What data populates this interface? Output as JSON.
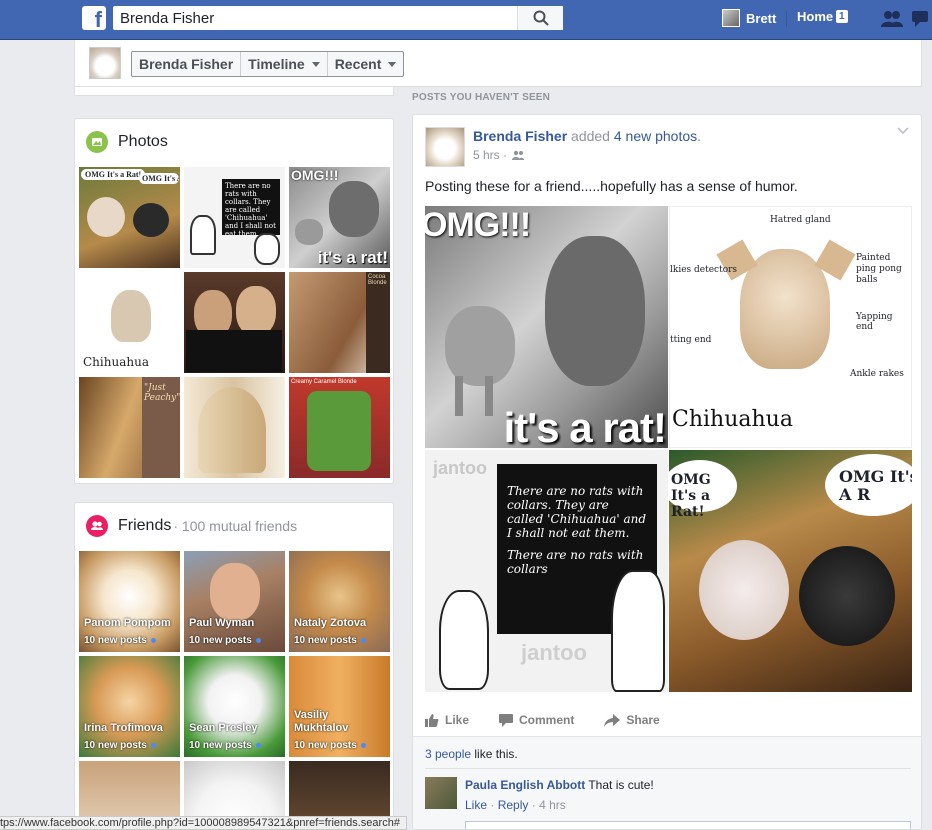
{
  "topbar": {
    "logo": "f",
    "search_value": "Brenda Fisher",
    "user_name": "Brett",
    "home_label": "Home",
    "home_badge": "1"
  },
  "profile_nav": {
    "name_label": "Brenda Fisher",
    "timeline_label": "Timeline",
    "recent_label": "Recent"
  },
  "photos": {
    "title": "Photos",
    "tiles": [
      {
        "caption": "OMG It's a Rat!",
        "extra": "OMG It's A R"
      },
      {
        "caption": "There are no rats with collars. They are called 'Chihuahua' and I shall not eat them."
      },
      {
        "caption": "OMG!!!",
        "extra": "it's a rat!"
      },
      {
        "caption": "Chihuahua"
      },
      {
        "caption": ""
      },
      {
        "caption": "Cocoa Blonde"
      },
      {
        "caption": "\"Just Peachy\""
      },
      {
        "caption": ""
      },
      {
        "caption": "Creamy Caramel Blonde"
      }
    ]
  },
  "friends": {
    "title": "Friends",
    "subtitle": "· 100 mutual friends",
    "list": [
      {
        "name": "Panom Pompom",
        "posts": "10 new posts"
      },
      {
        "name": "Paul Wyman",
        "posts": "10 new posts"
      },
      {
        "name": "Nataly Zotova",
        "posts": "10 new posts"
      },
      {
        "name": "Irina Trofimova",
        "posts": "10 new posts"
      },
      {
        "name": "Sean Presley",
        "posts": "10 new posts"
      },
      {
        "name": "Vasiliy Mukhtalov",
        "posts": "10 new posts"
      }
    ]
  },
  "feed": {
    "section_label": "POSTS YOU HAVEN'T SEEN",
    "post": {
      "author": "Brenda Fisher",
      "action": " added ",
      "action_link": "4 new photos",
      "action_end": ".",
      "time": "5 hrs ·",
      "text": "Posting these for a friend.....hopefully has a sense of humor.",
      "img1_top": "OMG!!!",
      "img1_bottom": "it's a rat!",
      "img2_title": "Chihuahua",
      "img2_labels": [
        "Hatred gland",
        "Painted ping pong balls",
        "Yapping end",
        "Ankle rakes",
        "lkies detectors",
        "tting end"
      ],
      "img3_text": "There are no rats with collars. They are called 'Chihuahua' and I shall not eat them.",
      "img3_text2": "There are no rats with collars",
      "img3_brand": "jantoo",
      "img4_left": "OMG It's a Rat!",
      "img4_right": "OMG It's A R",
      "actions": {
        "like": "Like",
        "comment": "Comment",
        "share": "Share"
      },
      "likes_link": "3 people",
      "likes_rest": " like this.",
      "comment": {
        "author": "Paula English Abbott",
        "text": " That is cute!",
        "like": "Like",
        "reply": "Reply",
        "time": "· 4 hrs"
      }
    }
  },
  "status_url": "tps://www.facebook.com/profile.php?id=100008989547321&pnref=friends.search#",
  "colors": {
    "brand": "#4267b2",
    "link": "#365899",
    "photos_icon": "#8bc34a",
    "friends_icon": "#e91e63"
  }
}
